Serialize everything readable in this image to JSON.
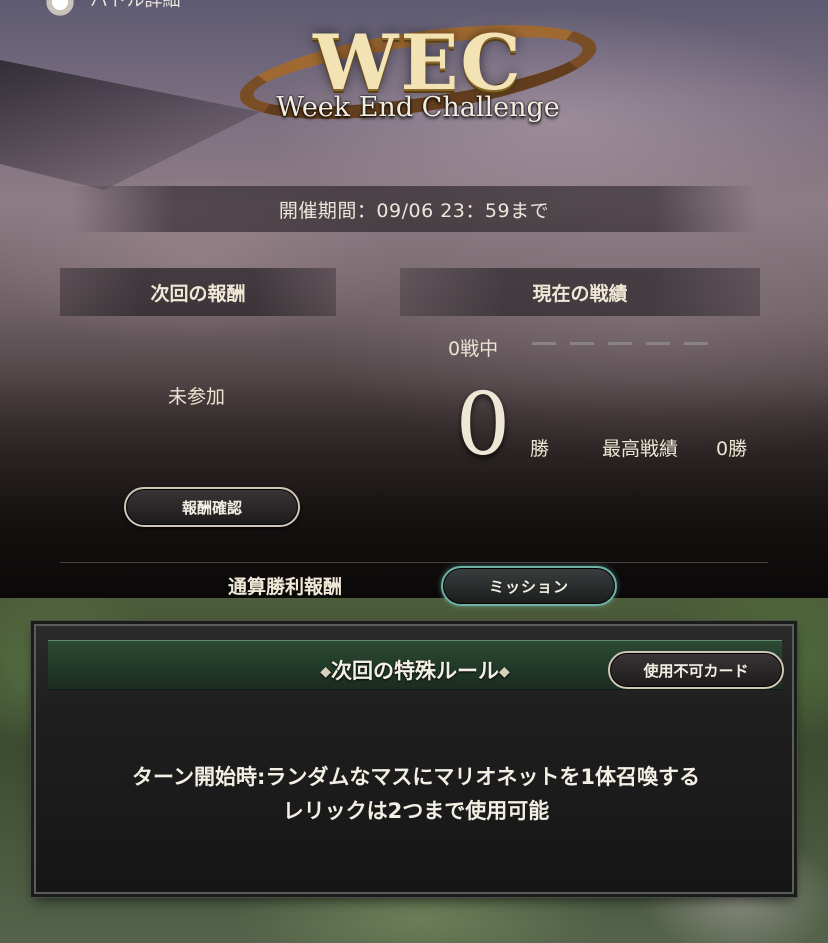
{
  "header": {
    "title": "バトル詳細",
    "icon": "emblem-icon"
  },
  "logo": {
    "main": "WEC",
    "subtitle": "Week End Challenge"
  },
  "period": {
    "text": "開催期間：09/06 23：59まで"
  },
  "reward": {
    "heading": "次回の報酬",
    "status": "未参加",
    "confirm_button": "報酬確認"
  },
  "record": {
    "heading": "現在の戦績",
    "in_battle": "0戦中",
    "wins": "0",
    "wins_unit": "勝",
    "best_label": "最高戦績",
    "best_value": "0勝",
    "progress_slots": 5
  },
  "tabs": {
    "total_rewards": "通算勝利報酬",
    "mission": "ミッション"
  },
  "special_rule": {
    "title": "次回の特殊ルール",
    "unusable_cards_button": "使用不可カード",
    "lines": [
      "ターン開始時:ランダムなマスにマリオネットを1体召喚する",
      "レリックは2つまで使用可能"
    ]
  },
  "colors": {
    "mission_glow": "#6fb3a6",
    "panel_header": "#2c4a34",
    "text": "#f4efe4"
  }
}
